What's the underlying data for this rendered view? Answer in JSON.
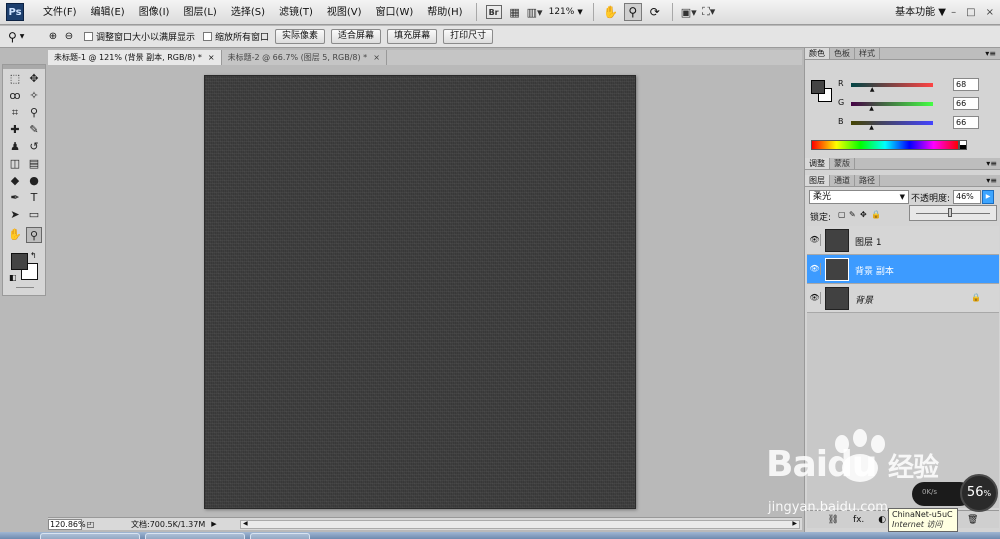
{
  "app": {
    "logo": "Ps",
    "menus": [
      "文件(F)",
      "编辑(E)",
      "图像(I)",
      "图层(L)",
      "选择(S)",
      "滤镜(T)",
      "视图(V)",
      "窗口(W)",
      "帮助(H)"
    ],
    "bridge_label": "Br",
    "zoom_level": "121%",
    "workspace": "基本功能",
    "workspace_arrow": "▼",
    "window_controls": [
      "–",
      "□",
      "×"
    ]
  },
  "options_bar": {
    "checkbox_resize": "调整窗口大小以满屏显示",
    "checkbox_zoom_all": "缩放所有窗口",
    "buttons": [
      "实际像素",
      "适合屏幕",
      "填充屏幕",
      "打印尺寸"
    ]
  },
  "documents": {
    "tabs": [
      {
        "label": "未标题-1 @ 121% (背景 副本, RGB/8) *",
        "active": true
      },
      {
        "label": "未标题-2 @ 66.7% (图层 5, RGB/8) *",
        "active": false
      }
    ],
    "close_glyph": "×"
  },
  "toolbox": {
    "tools": [
      {
        "name": "marquee-tool-icon",
        "glyph": "⬚"
      },
      {
        "name": "move-tool-icon",
        "glyph": "✥"
      },
      {
        "name": "lasso-tool-icon",
        "glyph": "ꝏ"
      },
      {
        "name": "magic-wand-tool-icon",
        "glyph": "✧"
      },
      {
        "name": "crop-tool-icon",
        "glyph": "⌗"
      },
      {
        "name": "eyedropper-tool-icon",
        "glyph": "⚲"
      },
      {
        "name": "healing-brush-tool-icon",
        "glyph": "✚"
      },
      {
        "name": "brush-tool-icon",
        "glyph": "✎"
      },
      {
        "name": "clone-stamp-tool-icon",
        "glyph": "♟"
      },
      {
        "name": "history-brush-tool-icon",
        "glyph": "↺"
      },
      {
        "name": "eraser-tool-icon",
        "glyph": "◫"
      },
      {
        "name": "gradient-tool-icon",
        "glyph": "▤"
      },
      {
        "name": "blur-tool-icon",
        "glyph": "◆"
      },
      {
        "name": "dodge-tool-icon",
        "glyph": "●"
      },
      {
        "name": "pen-tool-icon",
        "glyph": "✒"
      },
      {
        "name": "type-tool-icon",
        "glyph": "T"
      },
      {
        "name": "path-selection-tool-icon",
        "glyph": "➤"
      },
      {
        "name": "shape-tool-icon",
        "glyph": "▭"
      },
      {
        "name": "hand-tool-icon",
        "glyph": "✋"
      },
      {
        "name": "zoom-tool-icon",
        "glyph": "⚲"
      }
    ],
    "foreground_color": "#444444",
    "background_color": "#ffffff"
  },
  "status_bar": {
    "zoom": "120.86%",
    "doc_info": "文档:700.5K/1.37M"
  },
  "color_panel": {
    "tabs": [
      "颜色",
      "色板",
      "样式"
    ],
    "channels": [
      {
        "label": "R",
        "value": "68",
        "level": 0.267,
        "gradient": "linear-gradient(90deg, #004444, #ff4444)"
      },
      {
        "label": "G",
        "value": "66",
        "level": 0.259,
        "gradient": "linear-gradient(90deg, #440044, #44ff44)"
      },
      {
        "label": "B",
        "value": "66",
        "level": 0.259,
        "gradient": "linear-gradient(90deg, #444400, #4444ff)"
      }
    ]
  },
  "adjust_panel": {
    "tabs": [
      "调整",
      "蒙版"
    ]
  },
  "layers_panel": {
    "tabs": [
      "图层",
      "通道",
      "路径"
    ],
    "blend_mode": "柔光",
    "opacity_label": "不透明度:",
    "opacity_value": "46%",
    "opacity_level": 0.46,
    "lock_label": "锁定:",
    "layers": [
      {
        "name": "图层 1",
        "selected": false,
        "italic": false,
        "locked": false
      },
      {
        "name": "背景 副本",
        "selected": true,
        "italic": false,
        "locked": false
      },
      {
        "name": "背景",
        "selected": false,
        "italic": true,
        "locked": true
      }
    ],
    "footer_icons": [
      "⛓",
      "fx.",
      "◐",
      "◑",
      "▭",
      "▣",
      "🗑"
    ]
  },
  "overlay": {
    "watermark_brand": "Bai",
    "watermark_brand2": "du",
    "watermark_cn": "经验",
    "watermark_url": "jingyan.baidu.com",
    "speed_text": "0K/s",
    "speed_percent": "56",
    "percent_sign": "%",
    "tooltip_line1": "ChinaNet-u5uC",
    "tooltip_line2": "Internet 访问"
  }
}
